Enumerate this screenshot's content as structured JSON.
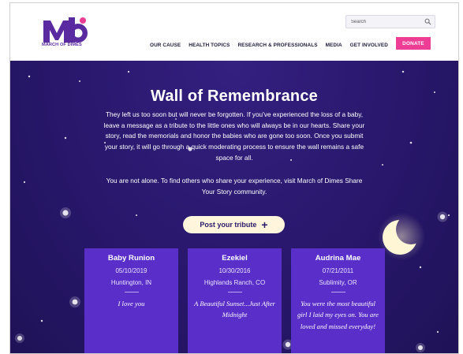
{
  "brand": {
    "logo_text": "MARCH OF DIMES",
    "colors": {
      "purple": "#5a2ba0",
      "pink": "#ee3d94",
      "night": "#28176b",
      "card": "#5a2ec8"
    }
  },
  "header": {
    "search_placeholder": "Search",
    "search_icon": "search-icon",
    "nav": [
      "OUR CAUSE",
      "HEALTH TOPICS",
      "RESEARCH & PROFESSIONALS",
      "MEDIA",
      "GET INVOLVED"
    ],
    "donate_label": "DONATE"
  },
  "hero": {
    "title": "Wall of Remembrance",
    "intro": "They left us too soon but will never be forgotten. If you've experienced the loss of a baby, leave a message as a tribute to the little ones who will always be in our hearts. Share your story, read the memorials and honor the babies who are gone too soon. Once you submit your story, it will go through a quick moderating process to ensure the wall remains a safe space for all.",
    "intro2": "You are not alone. To find others who share your experience, visit March of Dimes Share Your Story community.",
    "post_button": "Post your tribute",
    "post_icon": "+"
  },
  "cards": [
    {
      "name": "Baby Runion",
      "date": "05/10/2019",
      "place": "Huntington, IN",
      "message": "I love you"
    },
    {
      "name": "Ezekiel",
      "date": "10/30/2016",
      "place": "Highlands Ranch, CO",
      "message": "A Beautiful Sunset...Just After Midnight"
    },
    {
      "name": "Audrina Mae",
      "date": "07/21/2011",
      "place": "Sublimity, OR",
      "message": "You were the most beautiful girl I laid my eyes on. You are loved and missed everyday!"
    }
  ]
}
